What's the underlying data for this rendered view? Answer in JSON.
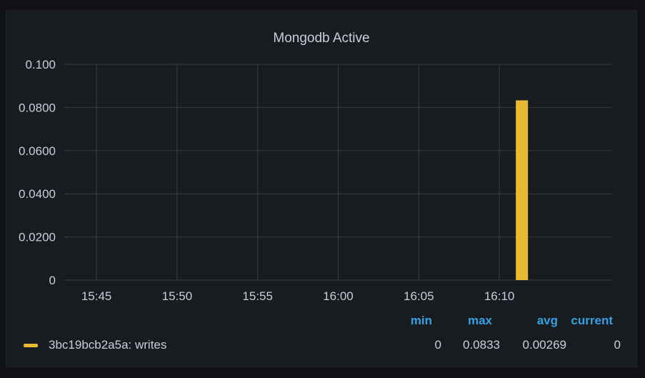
{
  "panel": {
    "title": "Mongodb Active"
  },
  "colors": {
    "series": "#e8b932",
    "grid": "#3a3d42",
    "legend_header": "#33a2e5"
  },
  "chart_data": {
    "type": "bar",
    "title": "Mongodb Active",
    "x_ticks": [
      "15:45",
      "15:50",
      "15:55",
      "16:00",
      "16:05",
      "16:10"
    ],
    "y_ticks": [
      "0",
      "0.0200",
      "0.0400",
      "0.0600",
      "0.0800",
      "0.100"
    ],
    "ylim": [
      0,
      0.1
    ],
    "xlim": [
      "15:43",
      "16:17"
    ],
    "grid": true,
    "series": [
      {
        "name": "3bc19bcb2a5a: writes",
        "color": "#e8b932",
        "points": [
          {
            "x": "16:11",
            "y": 0.0833
          }
        ]
      }
    ]
  },
  "legend": {
    "headers": {
      "min": "min",
      "max": "max",
      "avg": "avg",
      "current": "current"
    },
    "rows": [
      {
        "label": "3bc19bcb2a5a: writes",
        "min": "0",
        "max": "0.0833",
        "avg": "0.00269",
        "current": "0"
      }
    ]
  }
}
